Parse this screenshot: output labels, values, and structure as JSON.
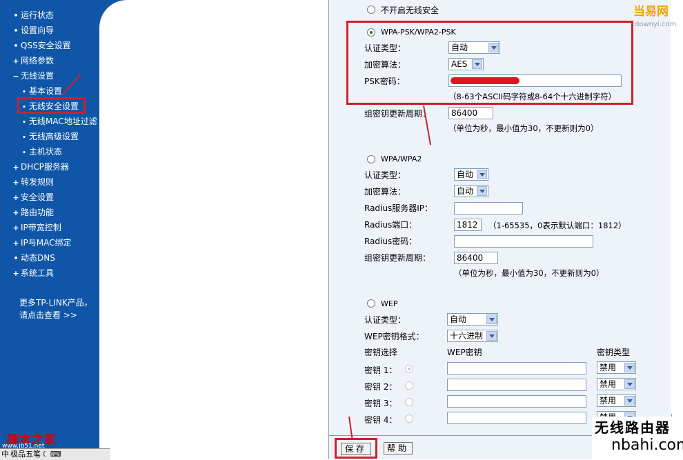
{
  "sidebar": {
    "items": [
      {
        "marker": "•",
        "label": "运行状态"
      },
      {
        "marker": "•",
        "label": "设置向导"
      },
      {
        "marker": "•",
        "label": "QSS安全设置"
      },
      {
        "marker": "+",
        "label": "网络参数"
      },
      {
        "marker": "−",
        "label": "无线设置"
      }
    ],
    "subitems": [
      {
        "marker": "•",
        "label": "基本设置"
      },
      {
        "marker": "•",
        "label": "无线安全设置"
      },
      {
        "marker": "•",
        "label": "无线MAC地址过滤"
      },
      {
        "marker": "•",
        "label": "无线高级设置"
      },
      {
        "marker": "•",
        "label": "主机状态"
      }
    ],
    "items2": [
      {
        "marker": "+",
        "label": "DHCP服务器"
      },
      {
        "marker": "+",
        "label": "转发规则"
      },
      {
        "marker": "+",
        "label": "安全设置"
      },
      {
        "marker": "+",
        "label": "路由功能"
      },
      {
        "marker": "+",
        "label": "IP带宽控制"
      },
      {
        "marker": "+",
        "label": "IP与MAC绑定"
      },
      {
        "marker": "•",
        "label": "动态DNS"
      },
      {
        "marker": "+",
        "label": "系统工具"
      }
    ],
    "more_line1": "更多TP-LINK产品，",
    "more_line2": "请点击查看 >>",
    "watermark": "脚本之家",
    "watermark_url": "www.jb51.net",
    "ime_text": "极品五笔"
  },
  "form": {
    "no_security_label": "不开启无线安全",
    "wpa_psk": {
      "title": "WPA-PSK/WPA2-PSK",
      "auth_label": "认证类型：",
      "auth_value": "自动",
      "enc_label": "加密算法：",
      "enc_value": "AES",
      "psk_label": "PSK密码：",
      "psk_hint": "（8-63个ASCII码字符或8-64个十六进制字符）",
      "gk_label": "组密钥更新周期：",
      "gk_value": "86400",
      "gk_hint": "（单位为秒，最小值为30，不更新则为0）"
    },
    "wpa": {
      "title": "WPA/WPA2",
      "auth_label": "认证类型：",
      "auth_value": "自动",
      "enc_label": "加密算法：",
      "enc_value": "自动",
      "radius_ip_label": "Radius服务器IP：",
      "radius_ip_value": "",
      "radius_port_label": "Radius端口：",
      "radius_port_value": "1812",
      "radius_port_hint": "（1-65535，0表示默认端口：1812）",
      "radius_pwd_label": "Radius密码：",
      "radius_pwd_value": "",
      "gk_label": "组密钥更新周期：",
      "gk_value": "86400",
      "gk_hint": "（单位为秒，最小值为30，不更新则为0）"
    },
    "wep": {
      "title": "WEP",
      "auth_label": "认证类型：",
      "auth_value": "自动",
      "format_label": "WEP密钥格式：",
      "format_value": "十六进制",
      "col_key_select": "密钥选择",
      "col_wep_key": "WEP密钥",
      "col_key_type": "密钥类型",
      "keys": [
        {
          "label": "密钥 1：",
          "type": "禁用"
        },
        {
          "label": "密钥 2：",
          "type": "禁用"
        },
        {
          "label": "密钥 3：",
          "type": "禁用"
        },
        {
          "label": "密钥 4：",
          "type": "禁用"
        }
      ]
    },
    "save_label": "保存",
    "help_label": "帮助"
  },
  "logos": {
    "dangyi": "当易网",
    "dangyi_url": "downyi.com",
    "router_text": "无线路由器",
    "router_url": "nbahi.com"
  },
  "colors": {
    "sidebar_bg": "#0f56a8",
    "highlight_red": "#d01e2a",
    "content_bg": "#eef3f9"
  }
}
